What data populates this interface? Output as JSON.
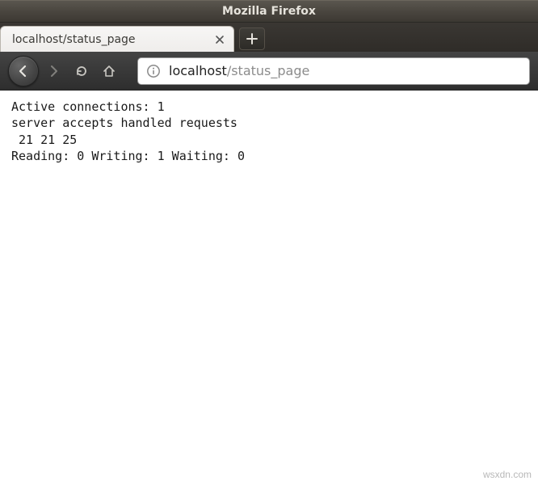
{
  "window": {
    "title": "Mozilla Firefox"
  },
  "tabs": {
    "active": {
      "title": "localhost/status_page"
    },
    "newtab_label": "+"
  },
  "navbar": {
    "url_host": "localhost",
    "url_path": "/status_page"
  },
  "page": {
    "line1": "Active connections: 1 ",
    "line2": "server accepts handled requests",
    "line3": " 21 21 25 ",
    "line4": "Reading: 0 Writing: 1 Waiting: 0 "
  },
  "status_data": {
    "active_connections": 1,
    "accepts": 21,
    "handled": 21,
    "requests": 25,
    "reading": 0,
    "writing": 1,
    "waiting": 0
  },
  "watermark": "wsxdn.com"
}
